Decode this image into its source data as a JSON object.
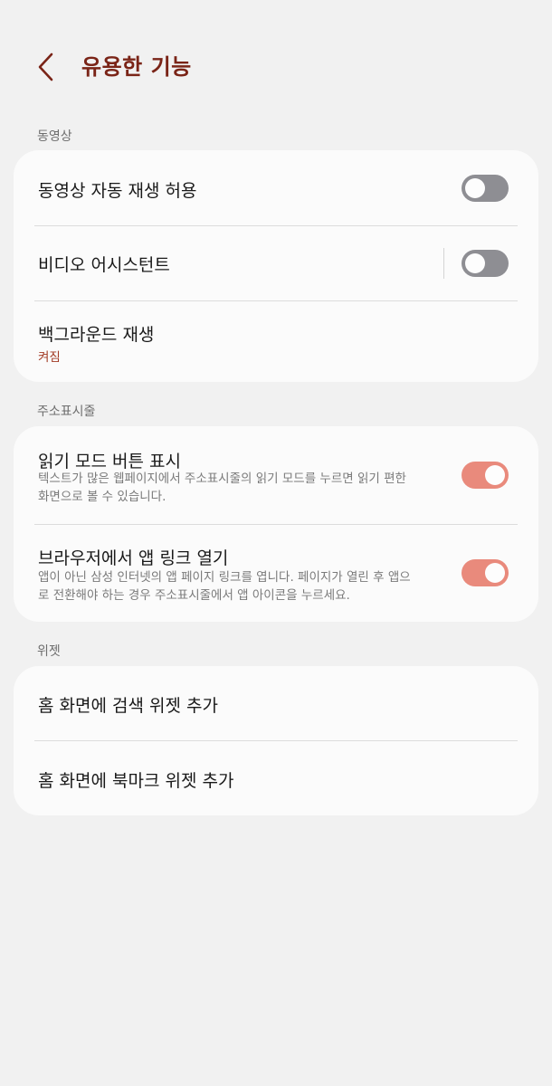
{
  "header": {
    "title": "유용한 기능",
    "back_icon": "chevron-left-icon",
    "accent_color": "#7a2417"
  },
  "sections": {
    "video": {
      "label": "동영상",
      "items": [
        {
          "title": "동영상 자동 재생 허용",
          "toggle": false
        },
        {
          "title": "비디오 어시스턴트",
          "toggle": false
        },
        {
          "title": "백그라운드 재생",
          "status": "켜짐"
        }
      ]
    },
    "address_bar": {
      "label": "주소표시줄",
      "items": [
        {
          "title": "읽기 모드 버튼 표시",
          "description": "텍스트가 많은 웹페이지에서 주소표시줄의 읽기 모드를 누르면 읽기 편한 화면으로 볼 수 있습니다.",
          "toggle": true
        },
        {
          "title": "브라우저에서 앱 링크 열기",
          "description": "앱이 아닌 삼성 인터넷의 앱 페이지 링크를 엽니다. 페이지가 열린 후 앱으로 전환해야 하는 경우 주소표시줄에서 앱 아이콘을 누르세요.",
          "toggle": true
        }
      ]
    },
    "widget": {
      "label": "위젯",
      "items": [
        {
          "title": "홈 화면에 검색 위젯 추가"
        },
        {
          "title": "홈 화면에 북마크 위젯 추가"
        }
      ]
    }
  },
  "colors": {
    "toggle_on": "#e98a7c",
    "toggle_off": "#8e8e93",
    "status_text": "#a23a24",
    "background": "#f1f1f1",
    "card": "#fbfbfb"
  }
}
